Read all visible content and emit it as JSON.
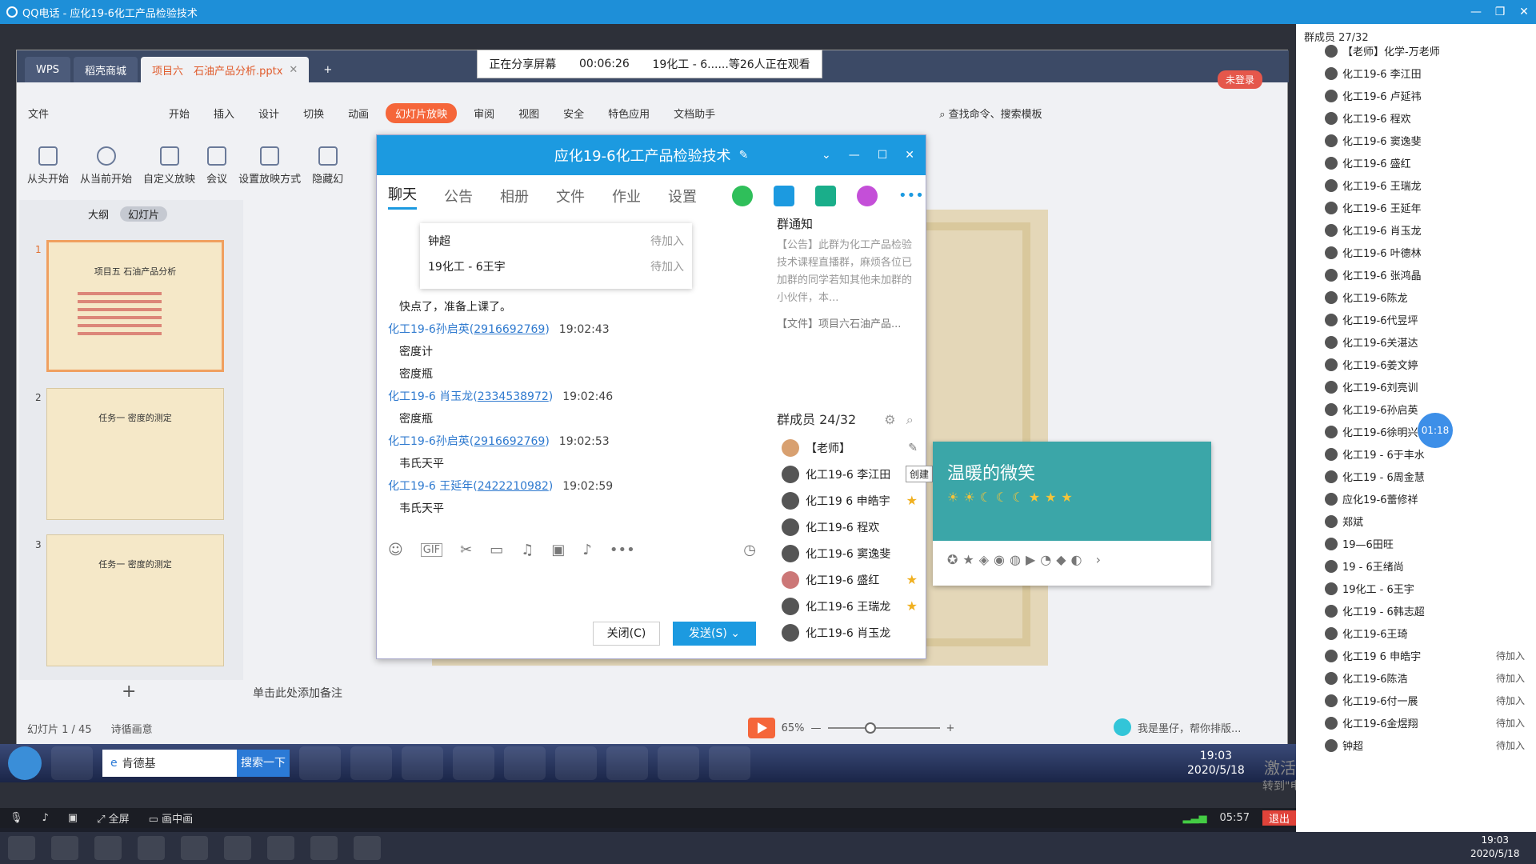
{
  "qq_window": {
    "title": "QQ电话 - 应化19-6化工产品检验技术"
  },
  "wps": {
    "tabs": [
      {
        "label": "WPS"
      },
      {
        "label": "稻壳商城"
      },
      {
        "label": "项目六　石油产品分析.pptx"
      }
    ],
    "unlogin": "未登录",
    "menu": [
      "文件",
      "开始",
      "插入",
      "设计",
      "切换",
      "动画",
      "幻灯片放映",
      "审阅",
      "视图",
      "安全",
      "特色应用",
      "文档助手"
    ],
    "search": "查找命令、搜索模板",
    "ribbon": [
      "从头开始",
      "从当前开始",
      "自定义放映",
      "会议",
      "设置放映方式",
      "隐藏幻"
    ],
    "panel_tabs": [
      "大纲",
      "幻灯片"
    ],
    "slides": [
      {
        "num": "1",
        "title": "项目五 石油产品分析"
      },
      {
        "num": "2",
        "title": "任务一 密度的测定"
      },
      {
        "num": "3",
        "title": "任务一 密度的测定"
      }
    ],
    "notes": "单击此处添加备注",
    "status": {
      "slide": "幻灯片 1 / 45",
      "theme": "诗循画意",
      "zoom": "65%",
      "hint": "我是墨仔，帮你排版..."
    }
  },
  "share_banner": {
    "label": "正在分享屏幕",
    "time": "00:06:26",
    "viewers": "19化工 - 6......等26人正在观看"
  },
  "chat": {
    "title": "应化19-6化工产品检验技术",
    "nav": [
      "聊天",
      "公告",
      "相册",
      "文件",
      "作业",
      "设置"
    ],
    "popup": [
      {
        "name": "钟超",
        "status": "待加入"
      },
      {
        "name": "19化工 - 6王宇",
        "status": "待加入"
      }
    ],
    "messages": [
      {
        "type": "text",
        "text": "快点了，准备上课了。"
      },
      {
        "type": "meta",
        "name": "化工19-6孙启英",
        "qq": "2916692769",
        "time": "19:02:43"
      },
      {
        "type": "text",
        "text": "密度计"
      },
      {
        "type": "text",
        "text": "密度瓶"
      },
      {
        "type": "meta",
        "name": "化工19-6 肖玉龙",
        "qq": "2334538972",
        "time": "19:02:46"
      },
      {
        "type": "text",
        "text": "密度瓶"
      },
      {
        "type": "meta",
        "name": "化工19-6孙启英",
        "qq": "2916692769",
        "time": "19:02:53"
      },
      {
        "type": "text",
        "text": "韦氏天平"
      },
      {
        "type": "meta",
        "name": "化工19-6 王延年",
        "qq": "2422210982",
        "time": "19:02:59"
      },
      {
        "type": "text",
        "text": "韦氏天平"
      }
    ],
    "close_btn": "关闭(C)",
    "send_btn": "发送(S)",
    "notice": {
      "title": "群通知",
      "text": "【公告】此群为化工产品检验技术课程直播群，麻烦各位已加群的同学若知其他未加群的小伙伴，本...",
      "file": "【文件】项目六石油产品..."
    },
    "members_head": "群成员 24/32",
    "members": [
      {
        "name": "【老师】",
        "star": false
      },
      {
        "name": "化工19-6 李江田",
        "star": false
      },
      {
        "name": "化工19 6 申皓宇",
        "star": true
      },
      {
        "name": "化工19-6 程欢",
        "star": false
      },
      {
        "name": "化工19-6 窦逸斐",
        "star": false
      },
      {
        "name": "化工19-6 盛红",
        "star": true
      },
      {
        "name": "化工19-6 王瑞龙",
        "star": true
      },
      {
        "name": "化工19-6 肖玉龙",
        "star": false
      }
    ],
    "create_tip": "创建"
  },
  "card": {
    "title": "温暖的微笑"
  },
  "taskbar7": {
    "search_text": "肯德基",
    "search_btn": "搜索一下",
    "time": "19:03",
    "date": "2020/5/18"
  },
  "activate": {
    "line1": "激活 Windows",
    "line2": "转到\"电脑设置\"以激活 Windows。"
  },
  "share_bar": {
    "fullscreen": "全屏",
    "pip": "画中画",
    "elapsed": "05:57",
    "exit": "退出"
  },
  "right_list": {
    "head": "群成员 27/32",
    "timer": "01:18",
    "members": [
      {
        "name": "【老师】化学-万老师",
        "status": ""
      },
      {
        "name": "化工19-6 李江田",
        "status": ""
      },
      {
        "name": "化工19-6 卢延祎",
        "status": ""
      },
      {
        "name": "化工19-6 程欢",
        "status": ""
      },
      {
        "name": "化工19-6 窦逸斐",
        "status": ""
      },
      {
        "name": "化工19-6 盛红",
        "status": ""
      },
      {
        "name": "化工19-6 王瑞龙",
        "status": ""
      },
      {
        "name": "化工19-6 王延年",
        "status": ""
      },
      {
        "name": "化工19-6 肖玉龙",
        "status": ""
      },
      {
        "name": "化工19-6 叶德林",
        "status": ""
      },
      {
        "name": "化工19-6 张鸿晶",
        "status": ""
      },
      {
        "name": "化工19-6陈龙",
        "status": ""
      },
      {
        "name": "化工19-6代昱坪",
        "status": ""
      },
      {
        "name": "化工19-6关湛达",
        "status": ""
      },
      {
        "name": "化工19-6姜文婷",
        "status": ""
      },
      {
        "name": "化工19-6刘亮训",
        "status": ""
      },
      {
        "name": "化工19-6孙启英",
        "status": ""
      },
      {
        "name": "化工19-6徐明兴",
        "status": ""
      },
      {
        "name": "化工19 - 6于丰水",
        "status": ""
      },
      {
        "name": "化工19 - 6周金慧",
        "status": ""
      },
      {
        "name": "应化19-6蕾修祥",
        "status": ""
      },
      {
        "name": "郑斌",
        "status": ""
      },
      {
        "name": "19—6田旺",
        "status": ""
      },
      {
        "name": "19 - 6王绪尚",
        "status": ""
      },
      {
        "name": "19化工 - 6王宇",
        "status": ""
      },
      {
        "name": "化工19 - 6韩志超",
        "status": ""
      },
      {
        "name": "化工19-6王琦",
        "status": ""
      },
      {
        "name": "化工19 6 申皓宇",
        "status": "待加入"
      },
      {
        "name": "化工19-6陈浩",
        "status": "待加入"
      },
      {
        "name": "化工19-6付一展",
        "status": "待加入"
      },
      {
        "name": "化工19-6金煜翔",
        "status": "待加入"
      },
      {
        "name": "钟超",
        "status": "待加入"
      }
    ]
  },
  "taskbar10": {
    "time": "19:03",
    "date": "2020/5/18"
  }
}
